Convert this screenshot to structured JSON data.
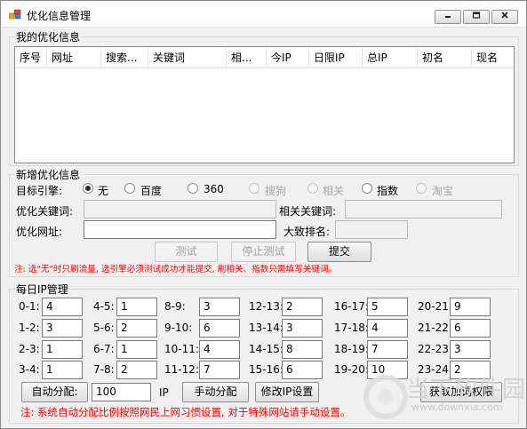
{
  "window": {
    "title": "优化信息管理",
    "controls": {
      "minimize": "minimize-icon",
      "maximize": "maximize-icon",
      "close": "close-icon"
    }
  },
  "my_info": {
    "group_label": "我的优化信息",
    "columns": [
      "序号",
      "网址",
      "搜索...",
      "关键词",
      "相...",
      "今IP",
      "日限IP",
      "总IP",
      "初名",
      "现名"
    ],
    "rows": []
  },
  "new_info": {
    "group_label": "新增优化信息",
    "engine_label": "目标引擎:",
    "engines": [
      "无",
      "百度",
      "360",
      "搜狗",
      "相关",
      "指数",
      "淘宝"
    ],
    "selected_engine": "无",
    "keyword_label": "优化关键词:",
    "keyword_value": "",
    "related_label": "相关关键词:",
    "related_value": "",
    "url_label": "优化网址:",
    "url_value": "",
    "rank_label": "大致排名:",
    "rank_value": "",
    "test_button": "测试",
    "stop_button": "停止测试",
    "submit_button": "提交",
    "note": "注: 选\"无\"时只刷流量, 选引擎必须测试成功才能提交, 刷相关、指数只需填写关键词。"
  },
  "daily_ip": {
    "group_label": "每日IP管理",
    "slots": [
      {
        "label": "0-1:",
        "value": "4"
      },
      {
        "label": "4-5:",
        "value": "1"
      },
      {
        "label": "8-9:",
        "value": "3"
      },
      {
        "label": "12-13:",
        "value": "2"
      },
      {
        "label": "16-17:",
        "value": "5"
      },
      {
        "label": "20-21:",
        "value": "9"
      },
      {
        "label": "1-2:",
        "value": "3"
      },
      {
        "label": "5-6:",
        "value": "2"
      },
      {
        "label": "9-10:",
        "value": "6"
      },
      {
        "label": "13-14:",
        "value": "3"
      },
      {
        "label": "17-18:",
        "value": "4"
      },
      {
        "label": "21-22:",
        "value": "6"
      },
      {
        "label": "2-3:",
        "value": "1"
      },
      {
        "label": "6-7:",
        "value": "1"
      },
      {
        "label": "10-11:",
        "value": "4"
      },
      {
        "label": "14-15:",
        "value": "8"
      },
      {
        "label": "18-19:",
        "value": "7"
      },
      {
        "label": "22-23:",
        "value": "3"
      },
      {
        "label": "3-4:",
        "value": "1"
      },
      {
        "label": "7-8:",
        "value": "2"
      },
      {
        "label": "11-12:",
        "value": "7"
      },
      {
        "label": "15-16:",
        "value": "6"
      },
      {
        "label": "19-20:",
        "value": "10"
      },
      {
        "label": "23-24:",
        "value": "2"
      }
    ],
    "auto_button": "自动分配:",
    "auto_value": "100",
    "ip_unit": "IP",
    "manual_button": "手动分配",
    "modify_button": "修改IP设置",
    "permission_button": "获取加词权限",
    "note": "注: 系统自动分配比例按照网民上网习惯设置, 对于特殊网站请手动设置。"
  },
  "watermark": {
    "text": "当下软件园",
    "url": "www.downxia.com"
  }
}
